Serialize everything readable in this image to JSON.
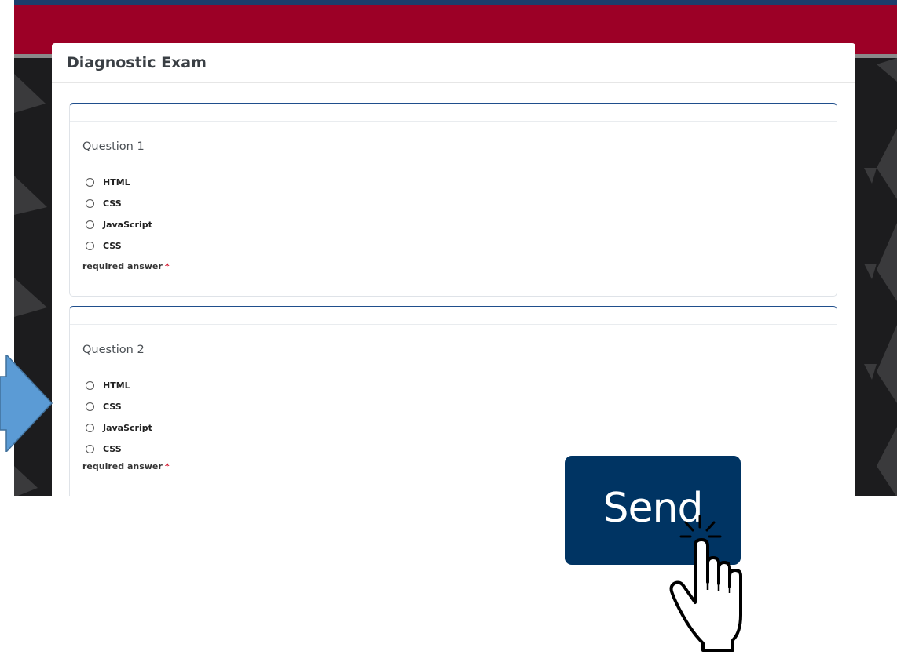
{
  "exam": {
    "title": "Diagnostic Exam",
    "questions": [
      {
        "title": "Question 1",
        "options": [
          "HTML",
          "CSS",
          "JavaScript",
          "CSS"
        ],
        "required_label": "required answer",
        "required_mark": "*"
      },
      {
        "title": "Question 2",
        "options": [
          "HTML",
          "CSS",
          "JavaScript",
          "CSS"
        ],
        "required_label": "required answer",
        "required_mark": "*"
      }
    ]
  },
  "send_button": {
    "label": "Send"
  },
  "icons": {
    "pointer": "hand-pointer-icon",
    "arrow": "arrow-right-icon",
    "radio": "radio-unchecked-icon"
  },
  "colors": {
    "header_red": "#9c0026",
    "accent_blue": "#1f4e8c",
    "send_bg": "#003463",
    "arrow_blue": "#5b9bd5",
    "required_star": "#d0021b"
  }
}
